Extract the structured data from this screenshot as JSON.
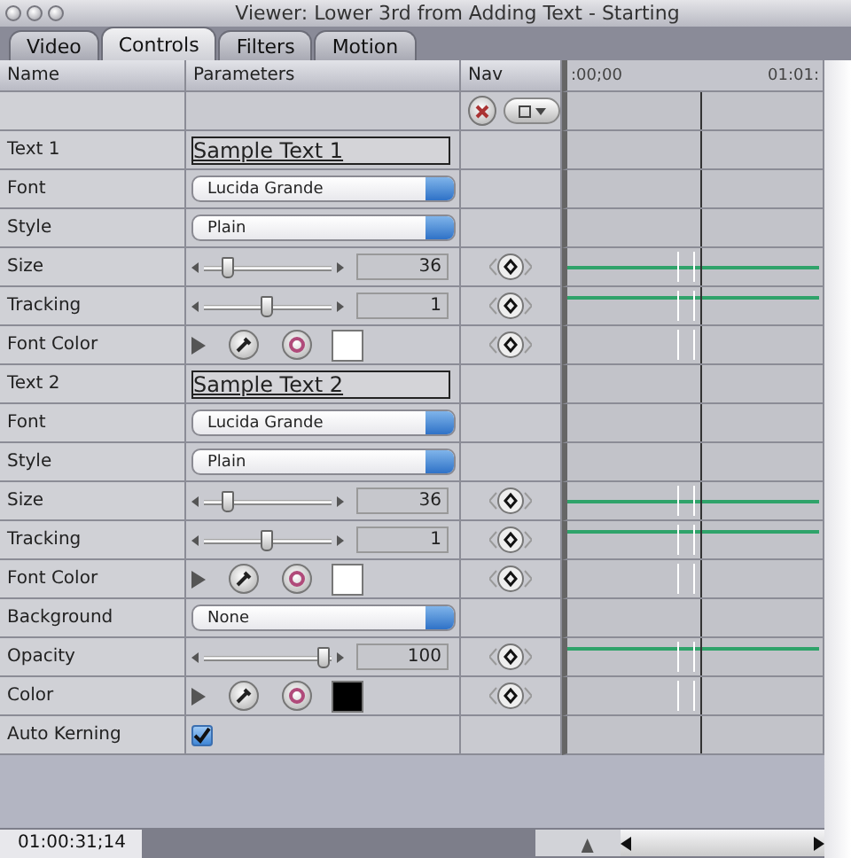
{
  "window": {
    "title": "Viewer: Lower 3rd from Adding Text - Starting"
  },
  "tabs": [
    {
      "label": "Video",
      "selected": false
    },
    {
      "label": "Controls",
      "selected": true
    },
    {
      "label": "Filters",
      "selected": false
    },
    {
      "label": "Motion",
      "selected": false
    }
  ],
  "columns": [
    "Name",
    "Parameters",
    "Nav"
  ],
  "timeline": {
    "start": ":00;00",
    "end": "01:01:"
  },
  "rows": [
    {
      "name": "Text 1",
      "kind": "text",
      "value": "Sample Text 1"
    },
    {
      "name": "Font",
      "kind": "popup",
      "value": "Lucida Grande"
    },
    {
      "name": "Style",
      "kind": "popup",
      "value": "Plain"
    },
    {
      "name": "Size",
      "kind": "slider",
      "level": 0.2,
      "value": "36"
    },
    {
      "name": "Tracking",
      "kind": "slider",
      "level": 0.5,
      "value": "1"
    },
    {
      "name": "Font Color",
      "kind": "color",
      "color": "#ffffff"
    },
    {
      "name": "Text 2",
      "kind": "text",
      "value": "Sample Text 2"
    },
    {
      "name": "Font",
      "kind": "popup",
      "value": "Lucida Grande"
    },
    {
      "name": "Style",
      "kind": "popup",
      "value": "Plain"
    },
    {
      "name": "Size",
      "kind": "slider",
      "level": 0.2,
      "value": "36"
    },
    {
      "name": "Tracking",
      "kind": "slider",
      "level": 0.5,
      "value": "1"
    },
    {
      "name": "Font Color",
      "kind": "color",
      "color": "#ffffff"
    },
    {
      "name": "Background",
      "kind": "popup",
      "value": "None"
    },
    {
      "name": "Opacity",
      "kind": "slider",
      "level": 0.95,
      "value": "100"
    },
    {
      "name": "Color",
      "kind": "color",
      "color": "#000000"
    },
    {
      "name": "Auto Kerning",
      "kind": "checkbox",
      "checked": true
    }
  ],
  "timecode": "01:00:31;14",
  "zoom_slider": {
    "level": 0.6
  }
}
